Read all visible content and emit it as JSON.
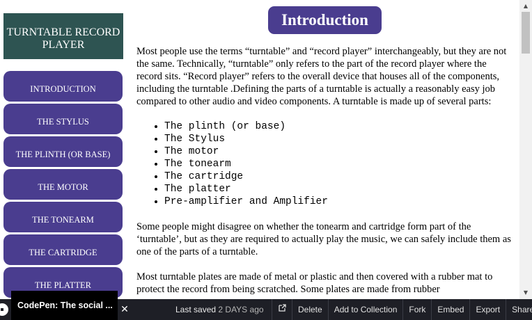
{
  "site": {
    "brand": "TURNTABLE RECORD PLAYER"
  },
  "nav": {
    "items": [
      "INTRODUCTION",
      "THE STYLUS",
      "THE PLINTH (OR BASE)",
      "THE MOTOR",
      "THE TONEARM",
      "THE CARTRIDGE",
      "THE PLATTER"
    ]
  },
  "main": {
    "title": "Introduction",
    "paragraphs": [
      "Most people use the terms “turntable” and “record player” interchangeably, but they are not the same. Technically, “turntable” only refers to the part of the record player where the record sits. “Record player” refers to the overall device that houses all of the components, including the turntable .Defining the parts of a turntable is actually a reasonably easy job compared to other audio and video components. A turntable is made up of several parts:",
      "Some people might disagree on whether the tonearm and cartridge form part of the ‘turntable’, but as they are required to actually play the music, we can safely include them as one of the parts of a turntable.",
      "Most turntable plates are made of metal or plastic and then covered with a rubber mat to protect the record from being scratched. Some plates are made from rubber"
    ],
    "parts": [
      "The plinth (or base)",
      "The Stylus",
      "The motor",
      "The tonearm",
      "The cartridge",
      "The platter",
      "Pre-amplifier and Amplifier"
    ]
  },
  "footer": {
    "tooltip": "CodePen: The social ...",
    "close_glyph": "✕",
    "last_saved_label": "Last saved",
    "last_saved_ago": "2 DAYS ago",
    "external_icon": "external-link-icon",
    "actions": [
      "Delete",
      "Add to Collection",
      "Fork",
      "Embed",
      "Export",
      "Share"
    ]
  },
  "colors": {
    "accent": "#4a3d8f",
    "brand_bg": "#2e5452",
    "footer_bg": "#1e1f26"
  }
}
